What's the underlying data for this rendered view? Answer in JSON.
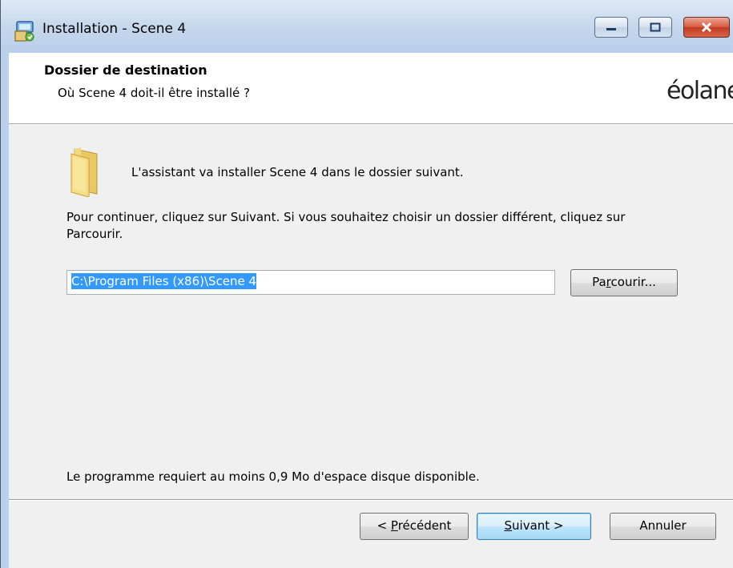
{
  "window": {
    "title": "Installation - Scene 4",
    "icon": "installer-icon"
  },
  "caption_buttons": {
    "minimize": "minimize-icon",
    "maximize": "maximize-icon",
    "close": "close-icon"
  },
  "header": {
    "title": "Dossier de destination",
    "subtitle": "Où Scene 4 doit-il être installé ?",
    "logo": "éolane"
  },
  "body": {
    "intro": "L'assistant va installer Scene 4 dans le dossier suivant.",
    "continue_text": "Pour continuer, cliquez sur Suivant. Si vous souhaitez choisir un dossier différent, cliquez sur Parcourir.",
    "path_value": "C:\\Program Files (x86)\\Scene 4",
    "browse": {
      "pre": "Pa",
      "mnemonic": "r",
      "post": "courir..."
    },
    "disk_space": "Le programme requiert au moins 0,9 Mo d'espace disque disponible."
  },
  "footer": {
    "prev": {
      "pre": "< ",
      "mnemonic": "P",
      "post": "récédent"
    },
    "next": {
      "pre": "",
      "mnemonic": "S",
      "post": "uivant >"
    },
    "cancel": "Annuler"
  },
  "colors": {
    "selection": "#3399ff",
    "close_button": "#c7442b",
    "dialog_bg": "#f0f0f0"
  }
}
